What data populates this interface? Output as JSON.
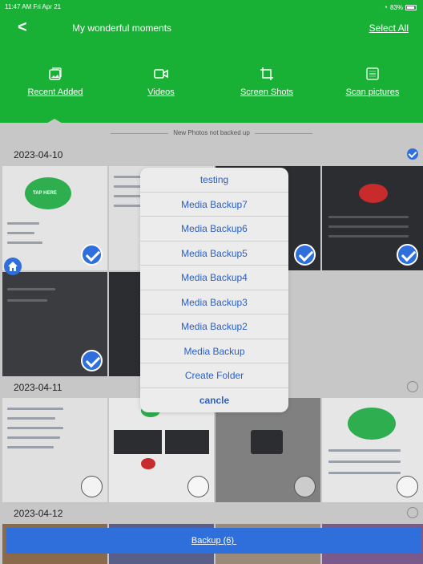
{
  "status": {
    "time": "11:47 AM  Fri Apr 21",
    "battery": "83%"
  },
  "header": {
    "back_glyph": "<",
    "title": "My wonderful moments",
    "select_all": "Select All"
  },
  "categories": [
    {
      "label": "Recent Added",
      "icon": "gallery-icon"
    },
    {
      "label": "Videos",
      "icon": "video-camera-icon"
    },
    {
      "label": "Screen Shots",
      "icon": "crop-icon"
    },
    {
      "label": "Scan pictures",
      "icon": "scan-icon"
    }
  ],
  "not_backed_label": "New Photos not backed up",
  "groups": [
    {
      "date": "2023-04-10",
      "checked": true
    },
    {
      "date": "2023-04-11",
      "checked": false
    },
    {
      "date": "2023-04-12",
      "checked": false
    }
  ],
  "thumb_text": {
    "tap_here": "TAP HERE"
  },
  "sheet": {
    "options": [
      "testing",
      "Media Backup7",
      "Media Backup6",
      "Media Backup5",
      "Media Backup4",
      "Media Backup3",
      "Media Backup2",
      "Media Backup",
      "Create Folder",
      "cancle"
    ]
  },
  "backup_button": "Backup (6) ",
  "colors": {
    "header_green": "#19b135",
    "accent_blue": "#2f6fdc",
    "sheet_text": "#2a60c9"
  }
}
